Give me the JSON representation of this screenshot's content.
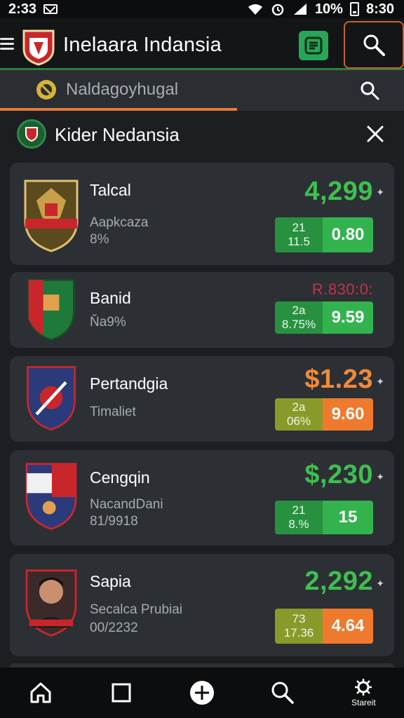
{
  "status_bar": {
    "time": "2:33",
    "battery": "10%",
    "clock": "8:30"
  },
  "header": {
    "title": "Inelaara Indansia"
  },
  "search": {
    "text": "Naldagoyhugal"
  },
  "filter": {
    "title": "Kider Nedansia"
  },
  "cards": [
    {
      "name": "Talcal",
      "sub1": "Aapkcaza",
      "sub2": "8%",
      "price": "4,299",
      "price_color": "#3fbf4f",
      "odds_left_top": "21",
      "odds_left_bottom": "11.5",
      "odds_right": "0.80",
      "odds_left_color": "#27913f",
      "odds_right_color": "#33b34e"
    },
    {
      "name": "Banid",
      "sub1": "Ňa9%",
      "sub2": "",
      "price": "R.830:0:",
      "price_color": "#c2334a",
      "odds_left_top": "2a",
      "odds_left_bottom": "8.75%",
      "odds_right": "9.59",
      "odds_left_color": "#27913f",
      "odds_right_color": "#33b34e"
    },
    {
      "name": "Pertandgia",
      "sub1": "Timaliet",
      "sub2": "",
      "price": "$1.23",
      "price_color": "#f08a3a",
      "odds_left_top": "2a",
      "odds_left_bottom": "06%",
      "odds_right": "9.60",
      "odds_left_color": "#8a9a2a",
      "odds_right_color": "#ef7a2e"
    },
    {
      "name": "Cengqin",
      "sub1": "NacandDani",
      "sub2": "81/9918",
      "price": "$,230",
      "price_color": "#3fbf4f",
      "odds_left_top": "21",
      "odds_left_bottom": "8.%",
      "odds_right": "15",
      "odds_left_color": "#27913f",
      "odds_right_color": "#33b34e"
    },
    {
      "name": "Sapia",
      "sub1": "Secalca Prubiai",
      "sub2": "00/2232",
      "price": "2,292",
      "price_color": "#3fbf4f",
      "odds_left_top": "73",
      "odds_left_bottom": "17.36",
      "odds_right": "4.64",
      "odds_left_color": "#8a9a2a",
      "odds_right_color": "#ef7a2e"
    }
  ],
  "nav": {
    "last_label": "Stareit"
  },
  "colors": {
    "accent_green": "#2f7d3c",
    "accent_orange": "#e07a3a",
    "background": "#1c1e21",
    "card": "#2c3035"
  }
}
